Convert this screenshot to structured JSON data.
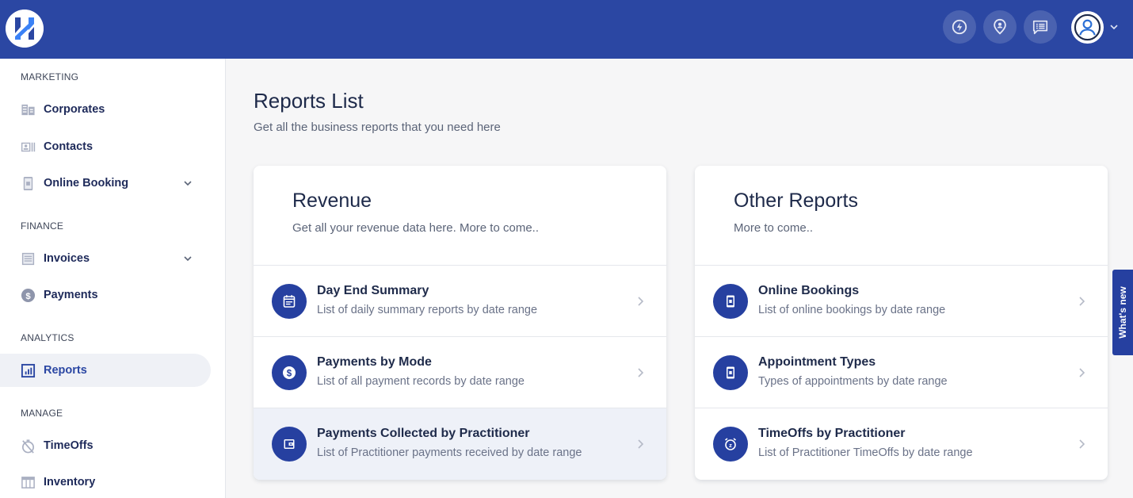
{
  "brand": {
    "logo_name": "H",
    "primary": "#2b47a3",
    "icon_bg": "#2640a0"
  },
  "topbar": {
    "icons": [
      {
        "name": "lightning-icon"
      },
      {
        "name": "location-person-icon"
      },
      {
        "name": "chat-list-icon"
      }
    ],
    "avatar": "user-avatar-icon"
  },
  "sidebar": {
    "sections": [
      {
        "label": "MARKETING"
      },
      {
        "label": "FINANCE"
      },
      {
        "label": "ANALYTICS"
      },
      {
        "label": "MANAGE"
      }
    ],
    "items": [
      {
        "label": "Corporates",
        "icon": "building-icon"
      },
      {
        "label": "Contacts",
        "icon": "contact-card-icon"
      },
      {
        "label": "Online Booking",
        "icon": "mobile-icon",
        "expandable": true
      },
      {
        "label": "Invoices",
        "icon": "invoice-icon",
        "expandable": true
      },
      {
        "label": "Payments",
        "icon": "dollar-icon"
      },
      {
        "label": "Reports",
        "icon": "chart-icon",
        "active": true
      },
      {
        "label": "TimeOffs",
        "icon": "timer-off-icon"
      },
      {
        "label": "Inventory",
        "icon": "table-icon"
      }
    ]
  },
  "main": {
    "title": "Reports List",
    "subtitle": "Get all the business reports that you need here",
    "cards": [
      {
        "title": "Revenue",
        "subtitle": "Get all your revenue data here. More to come..",
        "rows": [
          {
            "title": "Day End Summary",
            "desc": "List of daily summary reports by date range",
            "icon": "calendar-icon"
          },
          {
            "title": "Payments by Mode",
            "desc": "List of all payment records by date range",
            "icon": "dollar-icon"
          },
          {
            "title": "Payments Collected by Practitioner",
            "desc": "List of Practitioner payments received by date range",
            "icon": "wallet-icon"
          }
        ]
      },
      {
        "title": "Other Reports",
        "subtitle": "More to come..",
        "rows": [
          {
            "title": "Online Bookings",
            "desc": "List of online bookings by date range",
            "icon": "mobile-icon"
          },
          {
            "title": "Appointment Types",
            "desc": "Types of appointments by date range",
            "icon": "mobile-icon"
          },
          {
            "title": "TimeOffs by Practitioner",
            "desc": "List of Practitioner TimeOffs by date range",
            "icon": "alarm-snooze-icon"
          }
        ]
      }
    ]
  },
  "whats_new": "What's new"
}
